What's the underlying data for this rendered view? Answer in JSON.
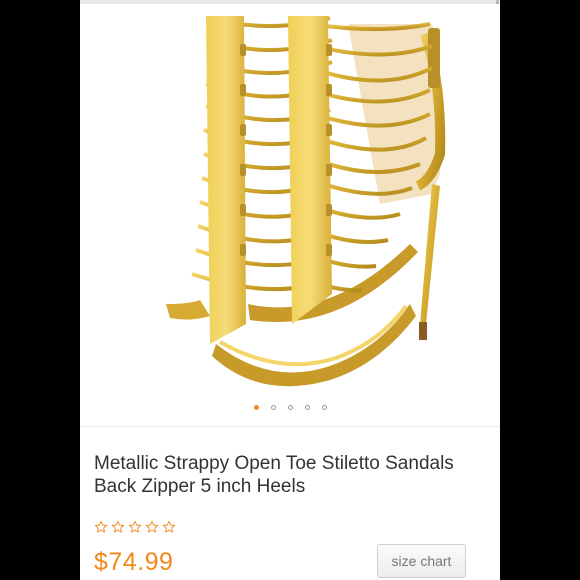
{
  "product": {
    "title": "Metallic Strappy Open Toe Stiletto Sandals Back Zipper 5 inch Heels",
    "price": "$74.99",
    "rating_stars": 5,
    "rating_filled": 0
  },
  "gallery": {
    "image_count": 5,
    "active_index": 0
  },
  "buttons": {
    "size_chart_label": "size chart"
  },
  "colors": {
    "accent": "#f08a1a",
    "gold": "#d8ae32"
  },
  "icons": {
    "rating": "star-outline-icon"
  }
}
